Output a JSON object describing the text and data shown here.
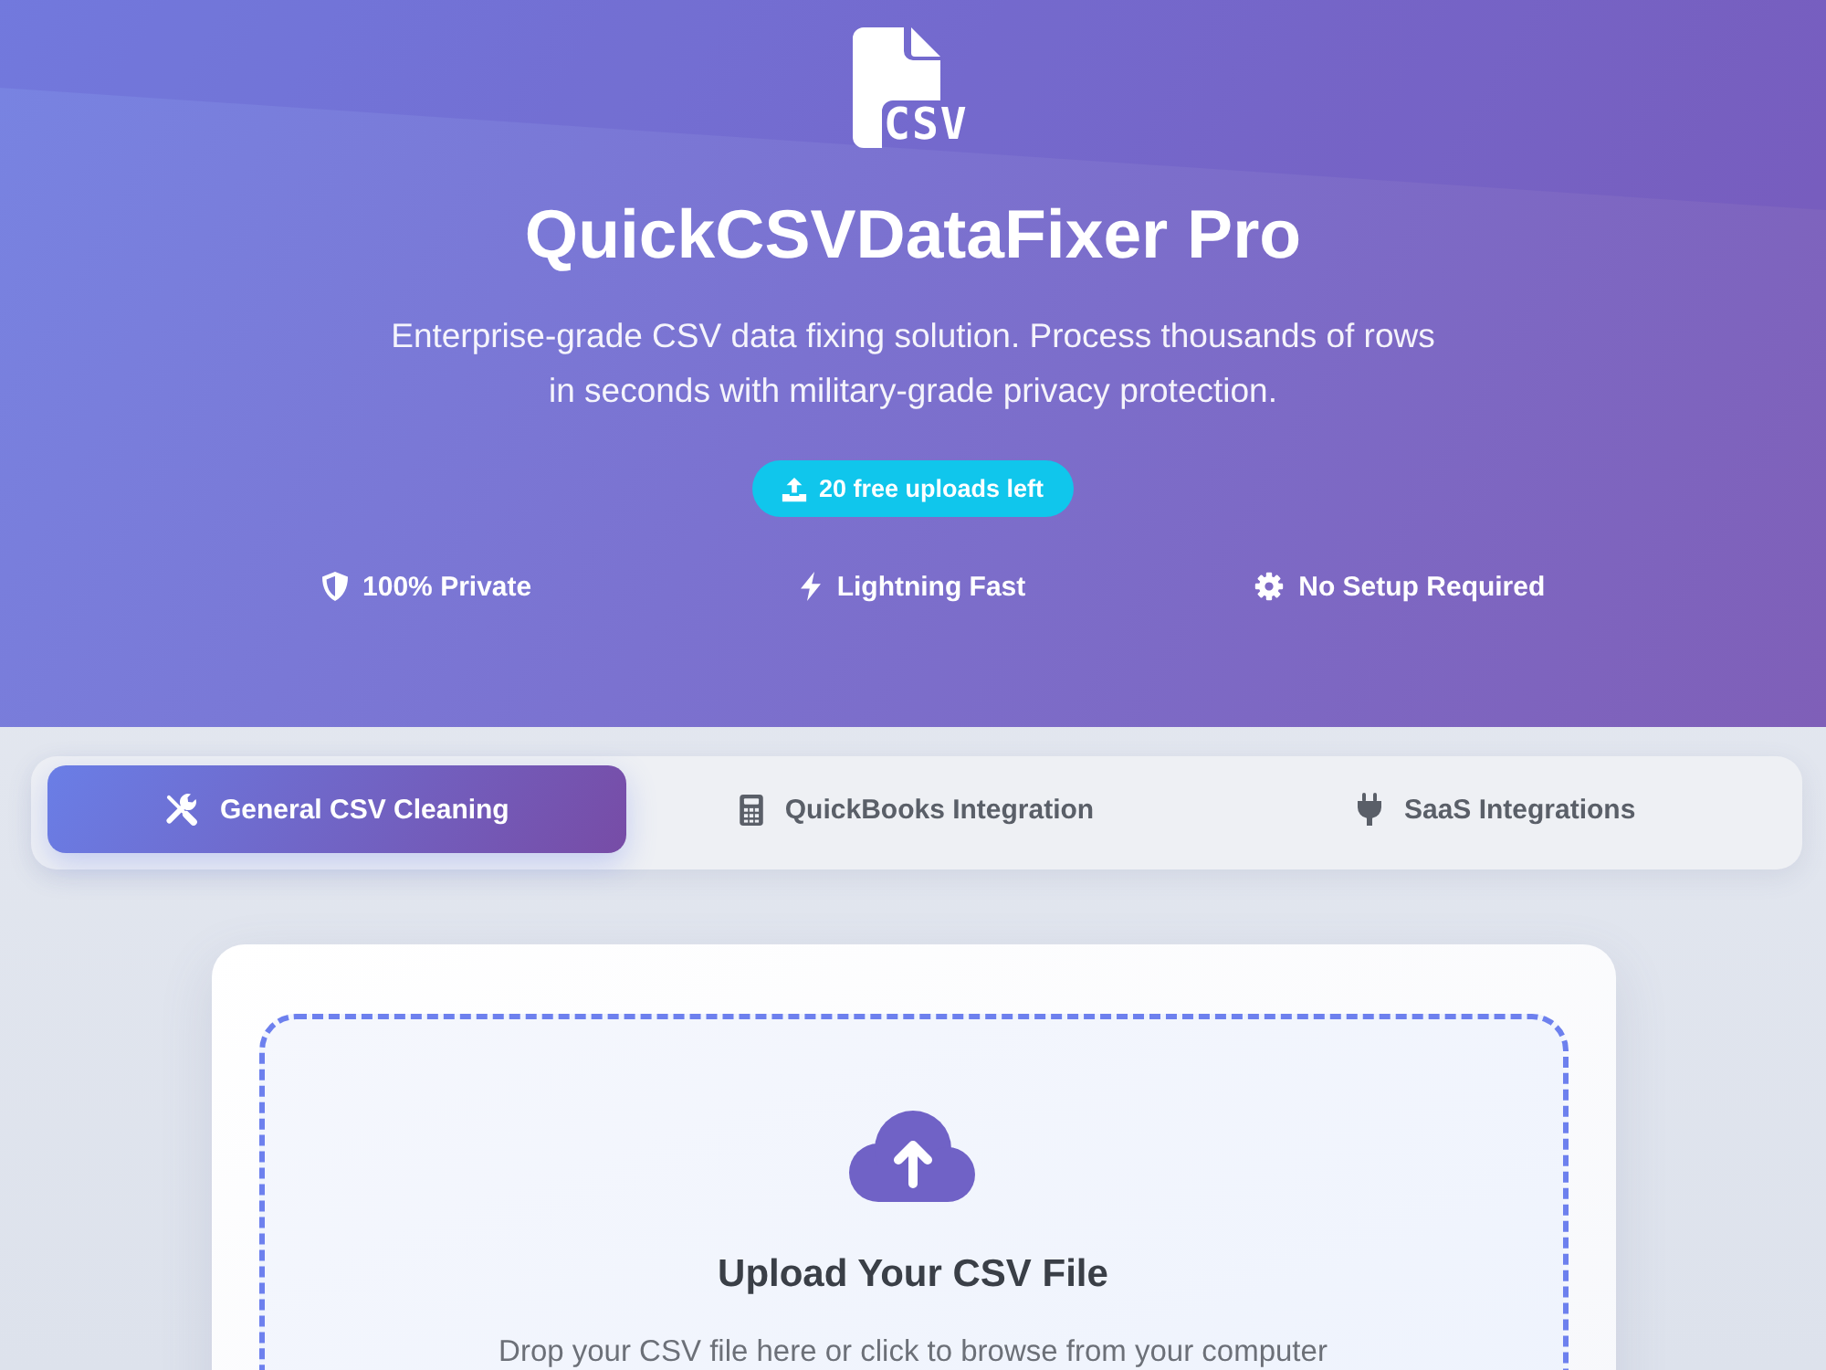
{
  "logo": {
    "text": "CSV"
  },
  "hero": {
    "title": "QuickCSVDataFixer Pro",
    "subtitle": "Enterprise-grade CSV data fixing solution. Process thousands of rows in seconds with military-grade privacy protection.",
    "badge": "20 free uploads left",
    "features": [
      {
        "label": "100% Private"
      },
      {
        "label": "Lightning Fast"
      },
      {
        "label": "No Setup Required"
      }
    ]
  },
  "tabs": [
    {
      "label": "General CSV Cleaning",
      "selected": true
    },
    {
      "label": "QuickBooks Integration",
      "selected": false
    },
    {
      "label": "SaaS Integrations",
      "selected": false
    }
  ],
  "upload": {
    "title": "Upload Your CSV File",
    "hint": "Drop your CSV file here or click to browse from your computer"
  }
}
